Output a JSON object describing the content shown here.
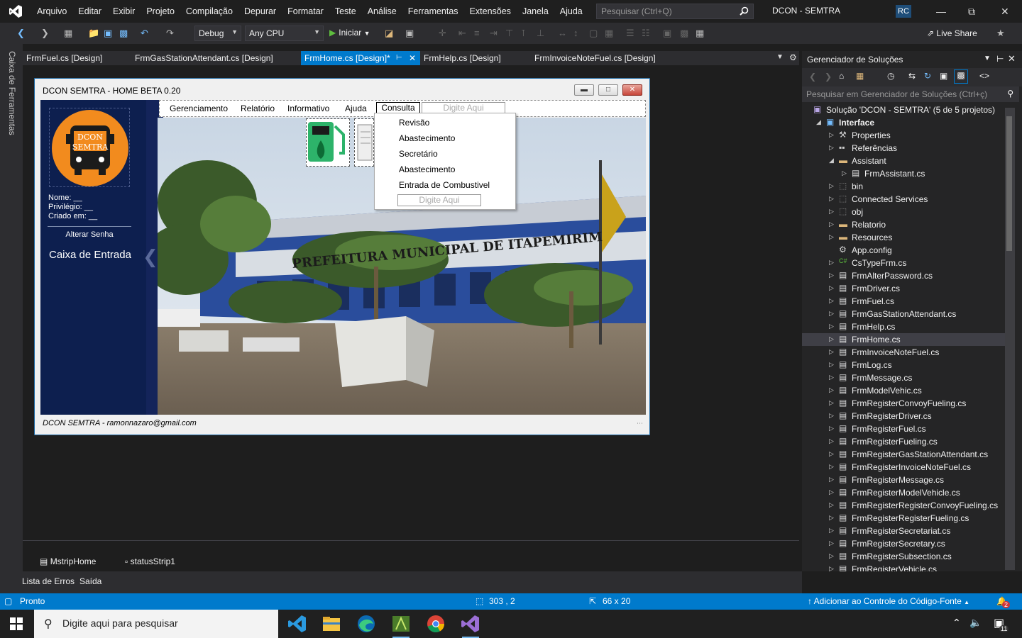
{
  "app": {
    "menu": [
      "Arquivo",
      "Editar",
      "Exibir",
      "Projeto",
      "Compilação",
      "Depurar",
      "Formatar",
      "Teste",
      "Análise",
      "Ferramentas",
      "Extensões",
      "Janela",
      "Ajuda"
    ],
    "search_placeholder": "Pesquisar (Ctrl+Q)",
    "solution_title": "DCON - SEMTRA",
    "avatar_initials": "RC",
    "toolbar": {
      "config": "Debug",
      "platform": "Any CPU",
      "start": "Iniciar",
      "live_share": "Live Share"
    },
    "toolbox_label": "Caixa de Ferramentas"
  },
  "tabs": [
    {
      "label": "FrmFuel.cs [Design]",
      "active": false
    },
    {
      "label": "FrmGasStationAttendant.cs [Design]",
      "active": false
    },
    {
      "label": "FrmHome.cs [Design]*",
      "active": true
    },
    {
      "label": "FrmHelp.cs [Design]",
      "active": false
    },
    {
      "label": "FrmInvoiceNoteFuel.cs [Design]",
      "active": false
    }
  ],
  "form": {
    "title": "DCON SEMTRA - HOME BETA 0.20",
    "logo_text": [
      "DCON",
      "SEMTRA"
    ],
    "user_info": [
      "Nome:  __",
      "Privilégio: __",
      "Criado em: __"
    ],
    "alter_password": "Alterar Senha",
    "inbox": "Caixa de Entrada",
    "menu": [
      "Gerenciamento",
      "Relatório",
      "Informativo",
      "Ajuda"
    ],
    "menu_active": "Consulta",
    "type_here": "Digite Aqui",
    "dropdown": [
      "Revisão",
      "Abastecimento",
      "Secretário",
      "Abastecimento",
      "Entrada de Combustivel"
    ],
    "status": "DCON SEMTRA - ramonnazaro@gmail.com",
    "building_sign": "PREFEITURA MUNICIPAL DE ITAPEMIRIM"
  },
  "tray": [
    "MstripHome",
    "statusStrip1"
  ],
  "bottom_tabs": [
    "Lista de Erros",
    "Saída"
  ],
  "solution_explorer": {
    "title": "Gerenciador de Soluções",
    "search_placeholder": "Pesquisar em Gerenciador de Soluções (Ctrl+ç)",
    "items": [
      {
        "label": "Solução 'DCON - SEMTRA' (5 de 5 projetos)",
        "level": 0,
        "icon": "solution",
        "expander": ""
      },
      {
        "label": "Interface",
        "level": 1,
        "icon": "project",
        "expander": "open",
        "bold": true
      },
      {
        "label": "Properties",
        "level": 2,
        "icon": "wrench",
        "expander": "closed"
      },
      {
        "label": "Referências",
        "level": 2,
        "icon": "refs",
        "expander": "closed"
      },
      {
        "label": "Assistant",
        "level": 2,
        "icon": "folder",
        "expander": "open"
      },
      {
        "label": "FrmAssistant.cs",
        "level": 3,
        "icon": "form",
        "expander": "closed"
      },
      {
        "label": "bin",
        "level": 2,
        "icon": "folder-dashed",
        "expander": "closed"
      },
      {
        "label": "Connected Services",
        "level": 2,
        "icon": "folder-dashed",
        "expander": "closed"
      },
      {
        "label": "obj",
        "level": 2,
        "icon": "folder-dashed",
        "expander": "closed"
      },
      {
        "label": "Relatorio",
        "level": 2,
        "icon": "folder",
        "expander": "closed"
      },
      {
        "label": "Resources",
        "level": 2,
        "icon": "folder",
        "expander": "closed"
      },
      {
        "label": "App.config",
        "level": 2,
        "icon": "config",
        "expander": ""
      },
      {
        "label": "CsTypeFrm.cs",
        "level": 2,
        "icon": "csharp",
        "expander": "closed"
      },
      {
        "label": "FrmAlterPassword.cs",
        "level": 2,
        "icon": "form",
        "expander": "closed"
      },
      {
        "label": "FrmDriver.cs",
        "level": 2,
        "icon": "form",
        "expander": "closed"
      },
      {
        "label": "FrmFuel.cs",
        "level": 2,
        "icon": "form",
        "expander": "closed"
      },
      {
        "label": "FrmGasStationAttendant.cs",
        "level": 2,
        "icon": "form",
        "expander": "closed"
      },
      {
        "label": "FrmHelp.cs",
        "level": 2,
        "icon": "form",
        "expander": "closed"
      },
      {
        "label": "FrmHome.cs",
        "level": 2,
        "icon": "form",
        "expander": "closed",
        "selected": true
      },
      {
        "label": "FrmInvoiceNoteFuel.cs",
        "level": 2,
        "icon": "form",
        "expander": "closed"
      },
      {
        "label": "FrmLog.cs",
        "level": 2,
        "icon": "form",
        "expander": "closed"
      },
      {
        "label": "FrmMessage.cs",
        "level": 2,
        "icon": "form",
        "expander": "closed"
      },
      {
        "label": "FrmModelVehic.cs",
        "level": 2,
        "icon": "form",
        "expander": "closed"
      },
      {
        "label": "FrmRegisterConvoyFueling.cs",
        "level": 2,
        "icon": "form",
        "expander": "closed"
      },
      {
        "label": "FrmRegisterDriver.cs",
        "level": 2,
        "icon": "form",
        "expander": "closed"
      },
      {
        "label": "FrmRegisterFuel.cs",
        "level": 2,
        "icon": "form",
        "expander": "closed"
      },
      {
        "label": "FrmRegisterFueling.cs",
        "level": 2,
        "icon": "form",
        "expander": "closed"
      },
      {
        "label": "FrmRegisterGasStationAttendant.cs",
        "level": 2,
        "icon": "form",
        "expander": "closed"
      },
      {
        "label": "FrmRegisterInvoiceNoteFuel.cs",
        "level": 2,
        "icon": "form",
        "expander": "closed"
      },
      {
        "label": "FrmRegisterMessage.cs",
        "level": 2,
        "icon": "form",
        "expander": "closed"
      },
      {
        "label": "FrmRegisterModelVehicle.cs",
        "level": 2,
        "icon": "form",
        "expander": "closed"
      },
      {
        "label": "FrmRegisterRegisterConvoyFueling.cs",
        "level": 2,
        "icon": "form",
        "expander": "closed"
      },
      {
        "label": "FrmRegisterRegisterFueling.cs",
        "level": 2,
        "icon": "form",
        "expander": "closed"
      },
      {
        "label": "FrmRegisterSecretariat.cs",
        "level": 2,
        "icon": "form",
        "expander": "closed"
      },
      {
        "label": "FrmRegisterSecretary.cs",
        "level": 2,
        "icon": "form",
        "expander": "closed"
      },
      {
        "label": "FrmRegisterSubsection.cs",
        "level": 2,
        "icon": "form",
        "expander": "closed"
      },
      {
        "label": "FrmRegisterVehicle.cs",
        "level": 2,
        "icon": "form",
        "expander": "closed"
      }
    ]
  },
  "status_bar": {
    "ready": "Pronto",
    "position": "303 , 2",
    "size": "66 x 20",
    "source_control": "Adicionar ao Controle do Código-Fonte",
    "notifications": "2"
  },
  "taskbar": {
    "search_placeholder": "Digite aqui para pesquisar",
    "apps": [
      "vscode-icon",
      "file-explorer-icon",
      "edge-icon",
      "android-studio-icon",
      "chrome-icon",
      "visual-studio-icon"
    ],
    "notification_count": "11"
  },
  "colors": {
    "accent": "#007acc",
    "sidebar": "#0d1f4f",
    "logo_orange": "#f28b1e"
  }
}
